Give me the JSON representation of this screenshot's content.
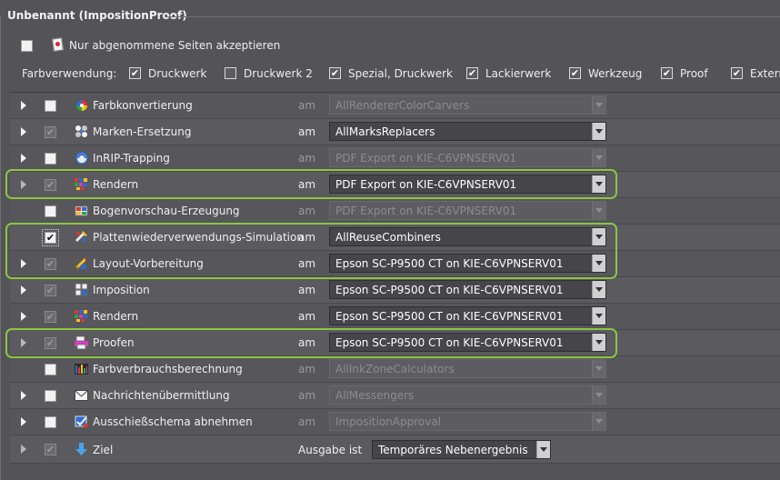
{
  "panel": {
    "title": "Unbenannt (ImpositionProof)"
  },
  "accept": {
    "label": "Nur abgenommene Seiten akzeptieren",
    "checked": false
  },
  "color_usage": {
    "label": "Farbverwendung:",
    "items": [
      {
        "label": "Druckwerk",
        "checked": true
      },
      {
        "label": "Druckwerk 2",
        "checked": false
      },
      {
        "label": "Spezial, Druckwerk",
        "checked": true
      },
      {
        "label": "Lackierwerk",
        "checked": true
      },
      {
        "label": "Werkzeug",
        "checked": true
      },
      {
        "label": "Proof",
        "checked": true
      },
      {
        "label": "Externe",
        "checked": true
      }
    ]
  },
  "rows": [
    {
      "name": "Farbkonvertierung",
      "icon": "color-wheel-icon",
      "checked": false,
      "am": "am",
      "value": "AllRendererColorCarvers",
      "active": false
    },
    {
      "name": "Marken-Ersetzung",
      "icon": "marks-icon",
      "checked": true,
      "am": "am",
      "value": "AllMarksReplacers",
      "active": true
    },
    {
      "name": "InRIP-Trapping",
      "icon": "trapping-icon",
      "checked": false,
      "am": "am",
      "value": "PDF Export on KIE-C6VPNSERV01",
      "active": false
    },
    {
      "name": "Rendern",
      "icon": "render-icon",
      "checked": true,
      "am": "am",
      "value": "PDF Export on KIE-C6VPNSERV01",
      "active": true
    },
    {
      "name": "Bogenvorschau-Erzeugung",
      "icon": "sheet-preview-icon",
      "checked": false,
      "am": "am",
      "value": "PDF Export on KIE-C6VPNSERV01",
      "active": false
    },
    {
      "name": "Plattenwiederverwendungs-Simulation",
      "icon": "plate-reuse-icon",
      "checked": true,
      "am": "am",
      "value": "AllReuseCombiners",
      "active": true
    },
    {
      "name": "Layout-Vorbereitung",
      "icon": "layout-prep-icon",
      "checked": true,
      "am": "am",
      "value": "Epson SC-P9500 CT on KIE-C6VPNSERV01",
      "active": true
    },
    {
      "name": "Imposition",
      "icon": "imposition-icon",
      "checked": true,
      "am": "am",
      "value": "Epson SC-P9500 CT on KIE-C6VPNSERV01",
      "active": true
    },
    {
      "name": "Rendern",
      "icon": "render-icon",
      "checked": true,
      "am": "am",
      "value": "Epson SC-P9500 CT on KIE-C6VPNSERV01",
      "active": true
    },
    {
      "name": "Proofen",
      "icon": "proof-icon",
      "checked": true,
      "am": "am",
      "value": "Epson SC-P9500 CT on KIE-C6VPNSERV01",
      "active": true
    },
    {
      "name": "Farbverbrauchsberechnung",
      "icon": "ink-calc-icon",
      "checked": false,
      "am": "am",
      "value": "AllInkZoneCalculators",
      "active": false
    },
    {
      "name": "Nachrichtenübermittlung",
      "icon": "message-icon",
      "checked": false,
      "am": "am",
      "value": "AllMessengers",
      "active": false
    },
    {
      "name": "Ausschießschema abnehmen",
      "icon": "approval-icon",
      "checked": false,
      "am": "am",
      "value": "ImpositionApproval",
      "active": false
    }
  ],
  "target": {
    "name": "Ziel",
    "icon": "down-arrow-icon",
    "checked": true,
    "label": "Ausgabe ist",
    "value": "Temporäres Nebenergebnis"
  }
}
